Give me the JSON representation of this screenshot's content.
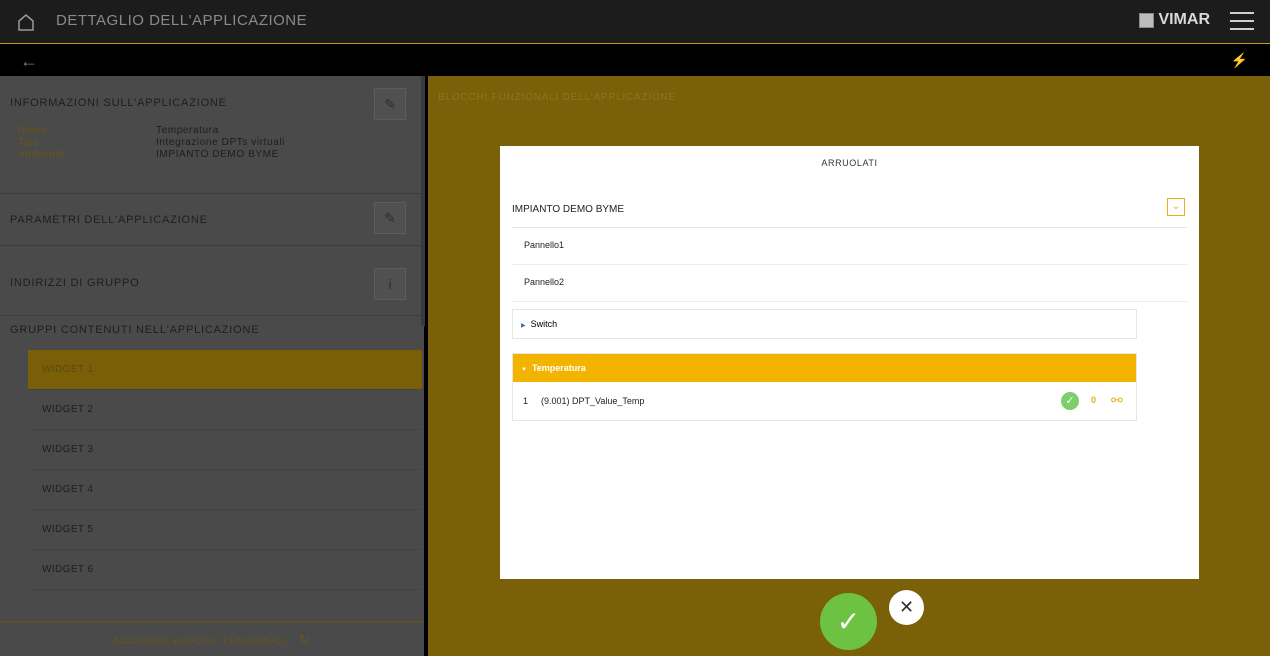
{
  "header": {
    "title": "DETTAGLIO DELL'APPLICAZIONE",
    "brand": "VIMAR",
    "back_symbol": "←",
    "plug_symbol": "⚡"
  },
  "left_panel": {
    "info_title": "INFORMAZIONI SULL'APPLICAZIONE",
    "info_rows": [
      {
        "key": "Nome",
        "value": "Temperatura"
      },
      {
        "key": "Tipo",
        "value": "Integrazione DPTs virtuali"
      },
      {
        "key": "Ambiente",
        "value": "IMPIANTO DEMO BYME"
      }
    ],
    "params_title": "PARAMETRI DELL'APPLICAZIONE",
    "group_addresses_title": "INDIRIZZI DI GRUPPO",
    "groups_title": "GRUPPI CONTENUTI NELL'APPLICAZIONE",
    "widgets": [
      "WIDGET 1",
      "WIDGET 2",
      "WIDGET 3",
      "WIDGET 4",
      "WIDGET 5",
      "WIDGET 6"
    ],
    "active_widget": "WIDGET 1",
    "update_label": "AGGIORNA BLOCCHI FUNZIONALI"
  },
  "right_panel": {
    "title": "BLOCCHI FUNZIONALI DELL'APPLICAZIONE"
  },
  "modal": {
    "title": "ARRUOLATI",
    "group": "IMPIANTO DEMO BYME",
    "devices": [
      "Pannello1",
      "Pannello2"
    ],
    "blocks": [
      {
        "name": "Switch",
        "expanded": false
      },
      {
        "name": "Temperatura",
        "expanded": true
      }
    ],
    "dpt": {
      "index": "1",
      "name": "(9.001) DPT_Value_Temp",
      "count": "0"
    }
  },
  "colors": {
    "accent": "#f3b400",
    "confirm": "#6dc242"
  },
  "icons": {
    "confirm": "✓",
    "cancel": "✕",
    "edit": "✎",
    "info": "i",
    "refresh": "↻",
    "chevron": "⌄",
    "link": "🔗"
  }
}
